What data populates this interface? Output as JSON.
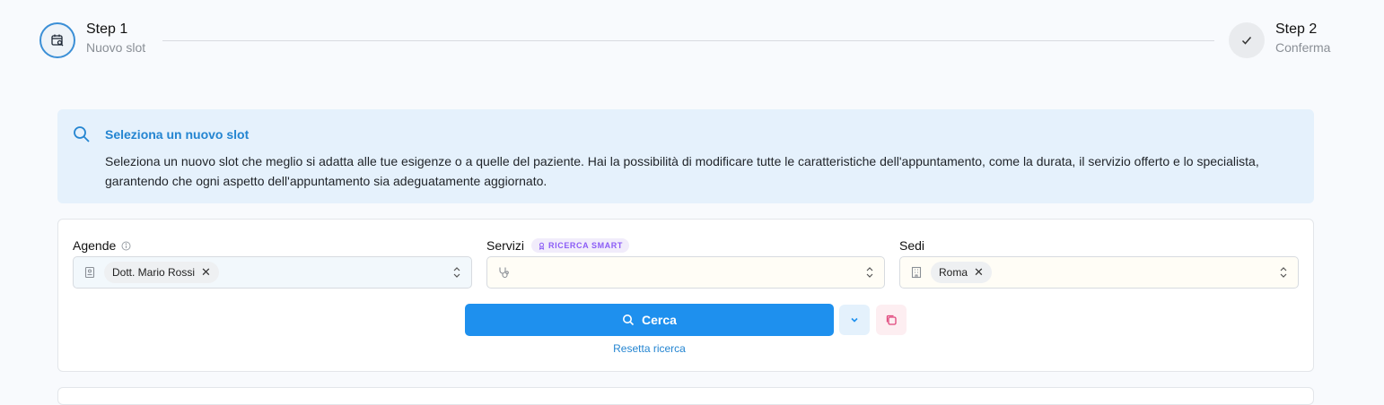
{
  "stepper": {
    "step1": {
      "title": "Step 1",
      "subtitle": "Nuovo slot",
      "icon": "calendar-search-icon"
    },
    "step2": {
      "title": "Step 2",
      "subtitle": "Conferma",
      "icon": "check-icon"
    }
  },
  "info": {
    "icon": "search-icon",
    "title": "Seleziona un nuovo slot",
    "text": "Seleziona un nuovo slot che meglio si adatta alle tue esigenze o a quelle del paziente. Hai la possibilità di modificare tutte le caratteristiche dell'appuntamento, come la durata, il servizio offerto e lo specialista, garantendo che ogni aspetto dell'appuntamento sia adeguatamente aggiornato."
  },
  "search": {
    "agende": {
      "label": "Agende",
      "selected": "Dott. Mario Rossi",
      "icon": "agenda-icon"
    },
    "servizi": {
      "label": "Servizi",
      "badge": "RICERCA SMART",
      "icon": "stethoscope-icon"
    },
    "sedi": {
      "label": "Sedi",
      "selected": "Roma",
      "icon": "building-icon"
    },
    "cerca_label": "Cerca",
    "reset_label": "Resetta ricerca"
  },
  "colors": {
    "primary": "#1e90ee",
    "info_bg": "#e5f1fc",
    "accent_text": "#2485d1",
    "smart_badge": "#8b5cf6",
    "copy_icon": "#e0457b"
  }
}
